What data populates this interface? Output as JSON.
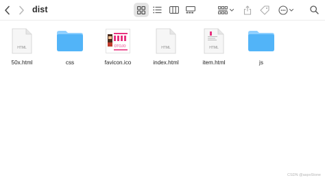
{
  "window": {
    "title": "dist"
  },
  "toolbar": {
    "back_icon": "chevron-left-icon",
    "forward_icon": "chevron-right-icon",
    "view_icons_icon": "grid-view-icon",
    "view_list_icon": "list-view-icon",
    "view_columns_icon": "column-view-icon",
    "view_gallery_icon": "gallery-view-icon",
    "group_icon": "group-by-icon",
    "share_icon": "share-icon",
    "tag_icon": "tag-icon",
    "more_icon": "more-actions-icon",
    "search_icon": "search-icon",
    "active_view": "icons"
  },
  "files": [
    {
      "name": "50x.html",
      "kind": "html",
      "badge": "HTML"
    },
    {
      "name": "css",
      "kind": "folder"
    },
    {
      "name": "favicon.ico",
      "kind": "ico"
    },
    {
      "name": "index.html",
      "kind": "html",
      "badge": "HTML"
    },
    {
      "name": "item.html",
      "kind": "html-preview",
      "badge": "HTML"
    },
    {
      "name": "js",
      "kind": "folder"
    }
  ],
  "favicon_text": "OTOJO",
  "watermark": "CSDN @aspoStone",
  "colors": {
    "folder_top": "#8fd0ff",
    "folder_body": "#52b4f8",
    "favicon_accent": "#e8317e",
    "selected_view_bg": "#e3e3e3"
  }
}
